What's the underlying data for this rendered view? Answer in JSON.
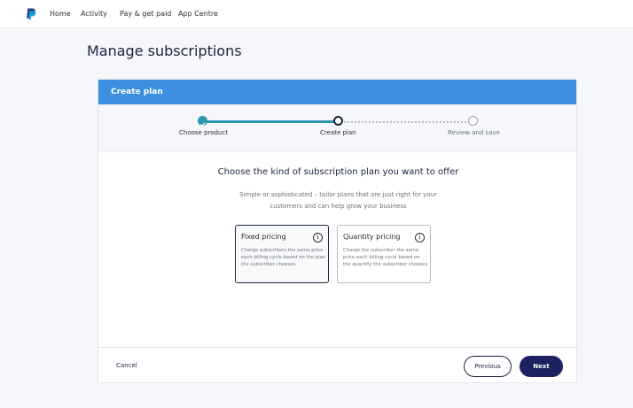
{
  "nav": {
    "logo_icon": "paypal-logo-icon",
    "items": [
      {
        "label": "Home"
      },
      {
        "label": "Activity"
      },
      {
        "label": "Pay & get paid"
      },
      {
        "label": "App Centre"
      }
    ]
  },
  "page": {
    "title": "Manage subscriptions"
  },
  "card": {
    "header_title": "Create plan",
    "steps": [
      {
        "label": "Choose product",
        "state": "done"
      },
      {
        "label": "Create plan",
        "state": "current"
      },
      {
        "label": "Review and save",
        "state": "todo"
      }
    ],
    "question": "Choose the kind of subscription plan you want to offer",
    "subtitle": "Simple or sophisticated – tailor plans that are just right for your customers and can help grow your business",
    "plans": [
      {
        "title": "Fixed pricing",
        "description": "Charge subscribers the same price each billing cycle based on the plan the subscriber chooses",
        "selected": true,
        "info_icon": "i"
      },
      {
        "title": "Quantity pricing",
        "description": "Charge the subscriber the same price each billing cycle based on the quantity the subscriber chooses",
        "selected": false,
        "info_icon": "i"
      }
    ],
    "footer": {
      "cancel_label": "Cancel",
      "previous_label": "Previous",
      "next_label": "Next"
    }
  },
  "colors": {
    "header_blue": "#3d8fe0",
    "progress_teal": "#2c96ad",
    "primary_navy": "#1b2161",
    "title_navy": "#1b2340"
  }
}
